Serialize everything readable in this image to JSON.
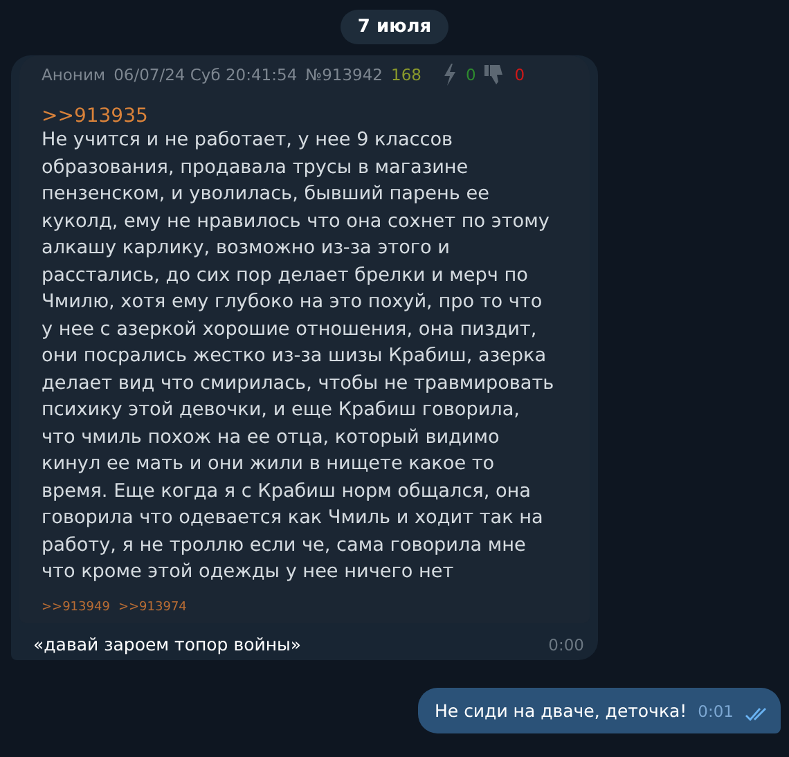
{
  "date_divider": "7 июля",
  "messages": [
    {
      "kind": "incoming",
      "post": {
        "author": "Аноним",
        "date": "06/07/24 Суб 20:41:54",
        "number": "№913942",
        "count": "168",
        "likes": "0",
        "dislikes": "0",
        "reply_to": ">>913935",
        "body": "Не учится и не работает, у нее 9 классов\nобразования, продавала трусы в магазине\nпензенском, и уволилась, бывший парень ее\nкуколд, ему не нравилось что она сохнет по этому\nалкашу карлику, возможно из-за этого и\nрасстались, до сих пор делает брелки и мерч по\nЧмилю, хотя ему глубоко на это похуй, про то что\nу нее с азеркой хорошие отношения, она пиздит,\nони посрались жестко из-за шизы Крабиш, азерка\nделает вид что смирилась, чтобы не травмировать\nпсихику этой девочки, и еще Крабиш говорила,\nчто чмиль похож на ее отца, который видимо\nкинул ее мать и они жили в нищете какое то\nвремя. Еще когда я с Крабиш норм общался, она\nговорила что одевается как Чмиль и ходит так на\nработу, я не троллю если че, сама говорила мне\nчто кроме этой одежды у нее ничего нет",
        "replies": [
          ">>913949",
          ">>913974"
        ]
      },
      "text": "«давай зароем топор войны»",
      "time": "0:00"
    },
    {
      "kind": "outgoing",
      "text": "Не сиди на дваче, деточка!",
      "time": "0:01",
      "read": true
    }
  ]
}
